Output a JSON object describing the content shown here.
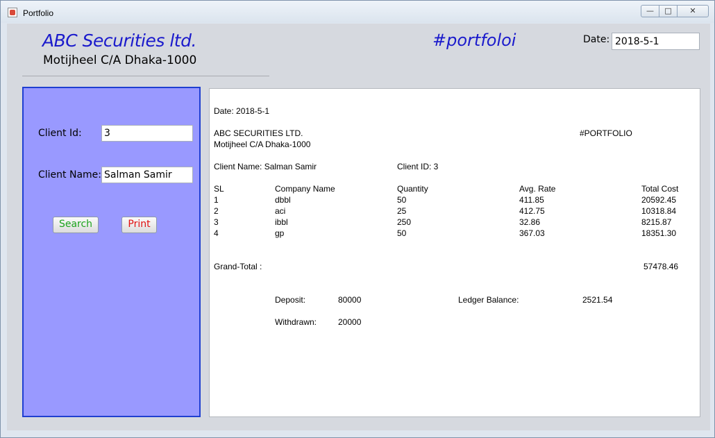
{
  "window": {
    "title": "Portfolio",
    "controls": {
      "minimize": "—",
      "maximize": "□",
      "close": "✕"
    }
  },
  "header": {
    "company_name": "ABC Securities ltd.",
    "address": "Motijheel C/A Dhaka-1000",
    "tag": "#portfoloi",
    "date_label": "Date:",
    "date_value": "2018-5-1"
  },
  "form": {
    "client_id_label": "Client Id:",
    "client_id_value": "3",
    "client_name_label": "Client Name:",
    "client_name_value": "Salman Samir",
    "search_label": "Search",
    "print_label": "Print",
    "panel_color": "#9999ff",
    "search_color": "#1ca31c",
    "print_color": "#e01010"
  },
  "report": {
    "date_line": "Date: 2018-5-1",
    "company_upper": "ABC SECURITIES LTD.",
    "address": "Motijheel C/A Dhaka-1000",
    "tag_upper": "#PORTFOLIO",
    "client_name_line": "Client Name: Salman Samir",
    "client_id_line": "Client ID: 3",
    "columns": [
      "SL",
      "Company Name",
      "Quantity",
      "Avg. Rate",
      "Total Cost"
    ],
    "rows": [
      [
        "1",
        "dbbl",
        "50",
        "411.85",
        "20592.45"
      ],
      [
        "2",
        "aci",
        "25",
        "412.75",
        "10318.84"
      ],
      [
        "3",
        "ibbl",
        "250",
        "32.86",
        "8215.87"
      ],
      [
        "4",
        "gp",
        "50",
        "367.03",
        "18351.30"
      ]
    ],
    "grand_total_label": "Grand-Total :",
    "grand_total_value": "57478.46",
    "deposit_label": "Deposit:",
    "deposit_value": "80000",
    "ledger_label": "Ledger Balance:",
    "ledger_value": "2521.54",
    "withdrawn_label": "Withdrawn:",
    "withdrawn_value": "20000"
  }
}
